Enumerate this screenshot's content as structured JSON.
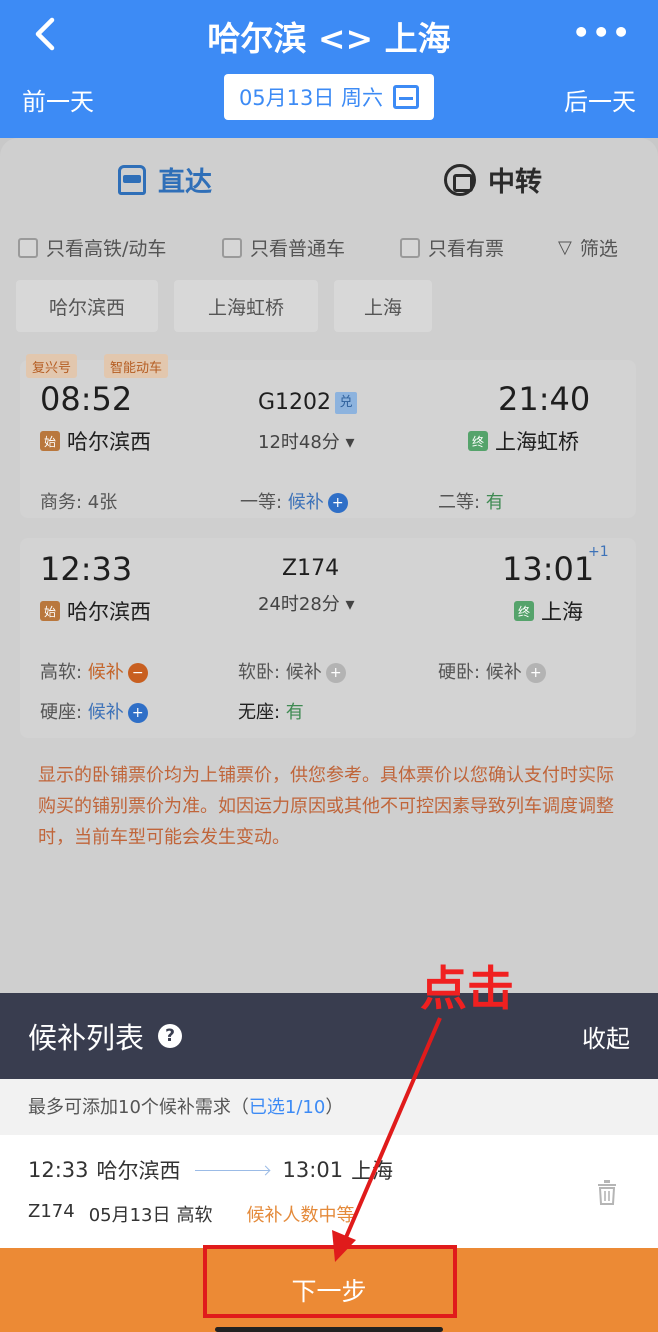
{
  "header": {
    "title": "哈尔滨 <> 上海",
    "prev_day": "前一天",
    "next_day": "后一天",
    "date": "05月13日 周六",
    "accent": "#3d8bf5"
  },
  "tabs": {
    "direct": "直达",
    "transfer": "中转"
  },
  "filters": [
    "只看高铁/动车",
    "只看普通车",
    "只看有票"
  ],
  "filter_button": "筛选",
  "stations": [
    "哈尔滨西",
    "上海虹桥",
    "上海"
  ],
  "trains": [
    {
      "badges": [
        "复兴号",
        "智能动车"
      ],
      "depart": "08:52",
      "from": "哈尔滨西",
      "from_icon": "始",
      "number": "G1202",
      "exchange": "兑",
      "duration": "12时48分",
      "arrive": "21:40",
      "to": "上海虹桥",
      "to_icon": "终",
      "seats": [
        {
          "label": "商务: ",
          "value": "4张"
        },
        {
          "label": "一等: ",
          "value": "候补"
        },
        {
          "label": "二等: ",
          "value": "有"
        }
      ]
    },
    {
      "depart": "12:33",
      "from": "哈尔滨西",
      "from_icon": "始",
      "number": "Z174",
      "duration": "24时28分",
      "arrive": "13:01",
      "arrive_offset": "+1",
      "to": "上海",
      "to_icon": "终",
      "seats": [
        {
          "label": "高软: ",
          "value": "候补"
        },
        {
          "label": "软卧: ",
          "value": "候补"
        },
        {
          "label": "硬卧: ",
          "value": "候补"
        },
        {
          "label": "硬座: ",
          "value": "候补"
        },
        {
          "label": "无座: ",
          "value": "有"
        }
      ]
    }
  ],
  "notice": "显示的卧铺票价均为上铺票价，供您参考。具体票价以您确认支付时实际购买的铺别票价为准。如因运力原因或其他不可控因素导致列车调度调整时，当前车型可能会发生变动。",
  "sheet": {
    "title": "候补列表",
    "help": "?",
    "collapse": "收起",
    "limit_text": "最多可添加10个候补需求（",
    "limit_selected": "已选1/10",
    "limit_close": "）",
    "item": {
      "depart": "12:33",
      "from": "哈尔滨西",
      "arrive": "13:01",
      "to": "上海",
      "train": "Z174",
      "date": "05月13日",
      "seat": "高软",
      "queue": "候补人数中等"
    },
    "next_button": "下一步"
  },
  "annotation": {
    "text": "点击",
    "color": "#e01b1b"
  }
}
